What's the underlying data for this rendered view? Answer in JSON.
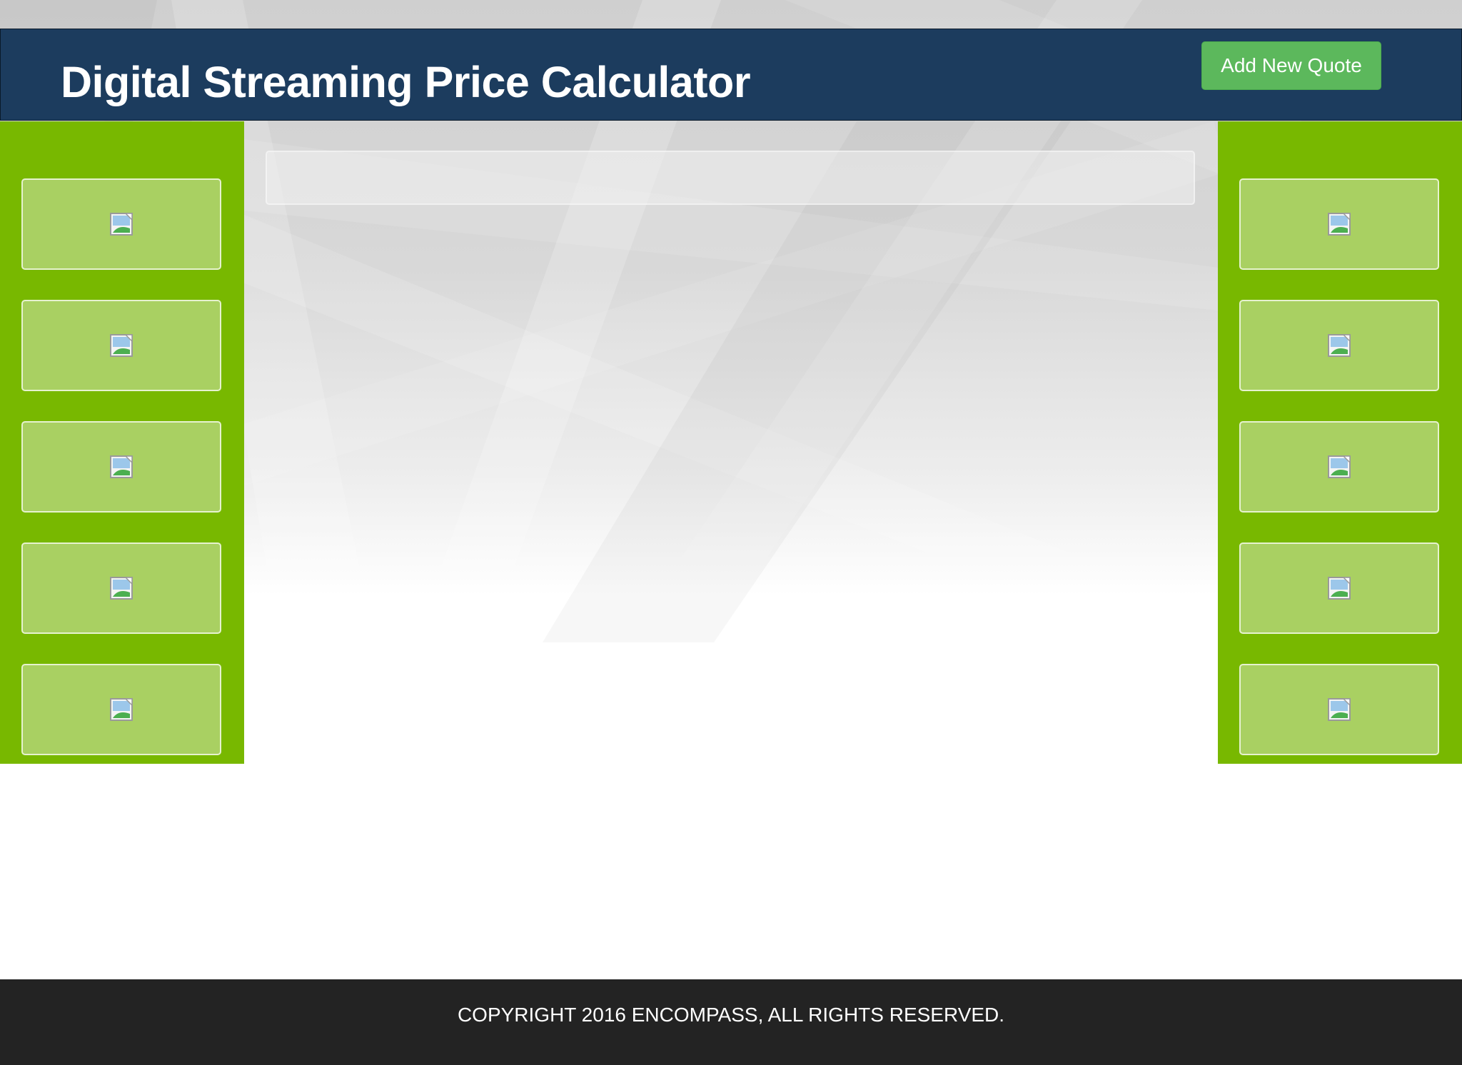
{
  "header": {
    "title": "Digital Streaming Price Calculator",
    "add_quote_label": "Add New Quote"
  },
  "left_panel": {
    "tiles": [
      {
        "icon": "broken-image-icon"
      },
      {
        "icon": "broken-image-icon"
      },
      {
        "icon": "broken-image-icon"
      },
      {
        "icon": "broken-image-icon"
      },
      {
        "icon": "broken-image-icon"
      }
    ]
  },
  "right_panel": {
    "tiles": [
      {
        "icon": "broken-image-icon"
      },
      {
        "icon": "broken-image-icon"
      },
      {
        "icon": "broken-image-icon"
      },
      {
        "icon": "broken-image-icon"
      },
      {
        "icon": "broken-image-icon"
      }
    ]
  },
  "footer": {
    "copyright": "COPYRIGHT 2016 ENCOMPASS, ALL RIGHTS RESERVED."
  },
  "colors": {
    "header_bg": "#1c3c5e",
    "button_green": "#5cb85c",
    "panel_green": "#78b800",
    "tile_green": "#a9d062",
    "footer_bg": "#232323"
  }
}
